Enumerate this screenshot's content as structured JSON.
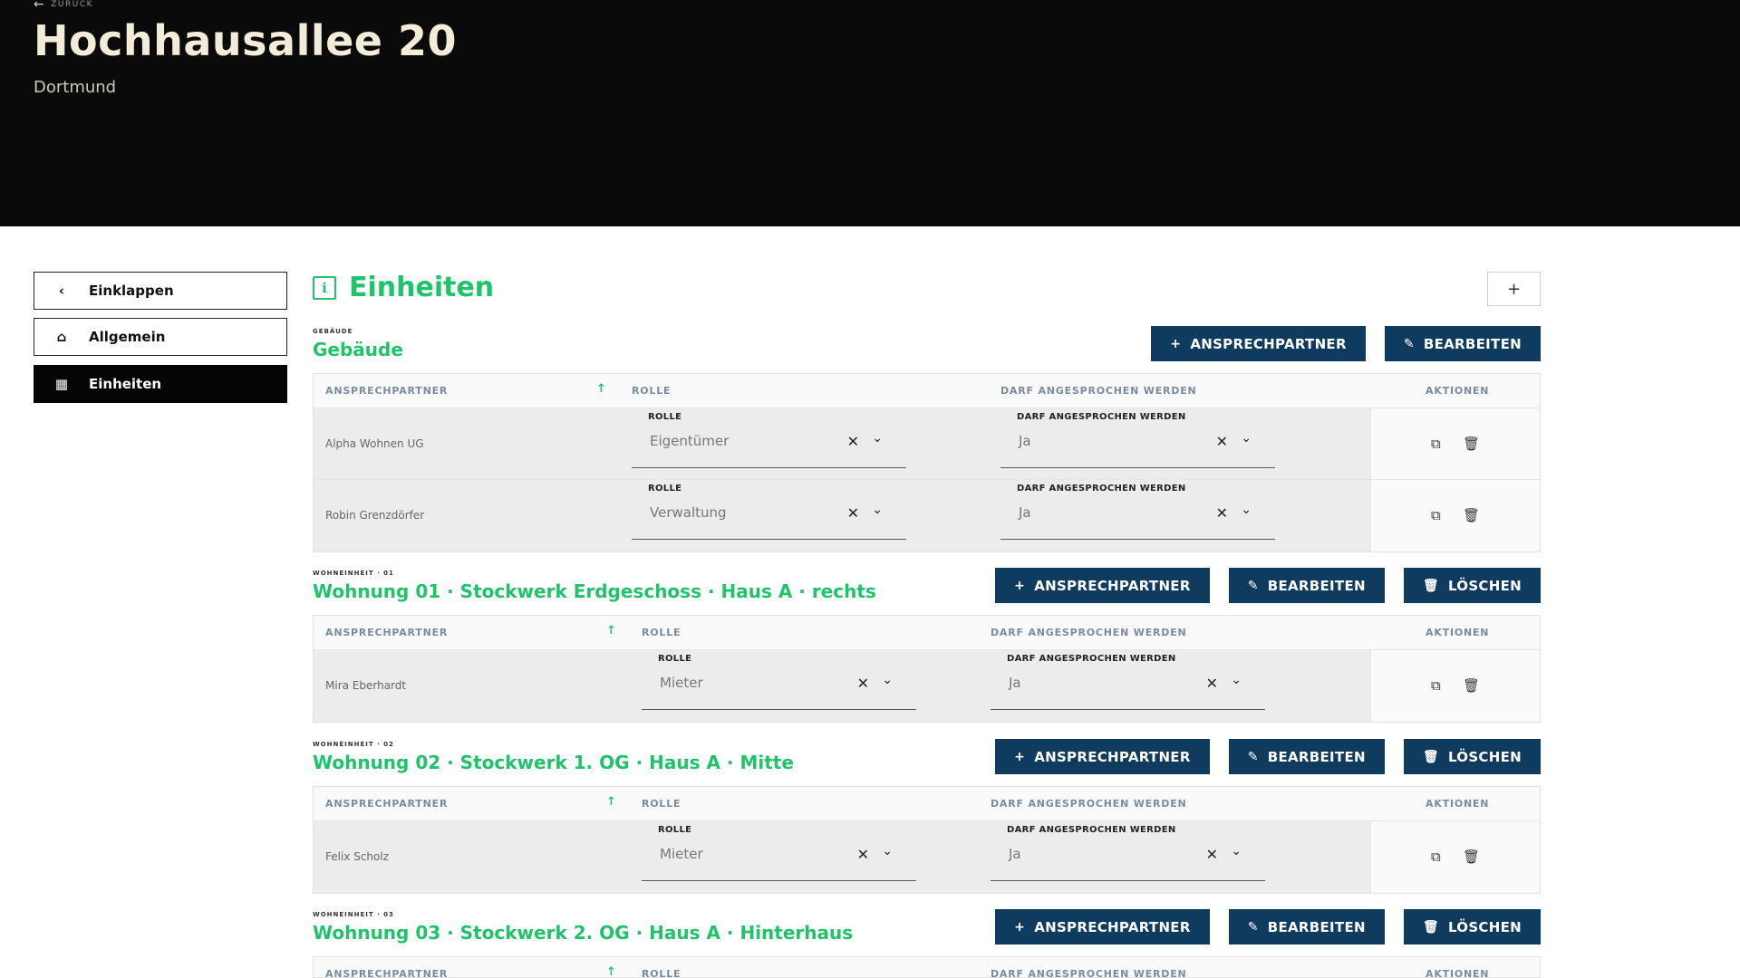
{
  "header": {
    "back_label": "ZURÜCK",
    "title": "Hochhausallee 20",
    "subtitle": "Dortmund"
  },
  "sidebar": {
    "items": [
      {
        "label": "Einklappen",
        "icon": "chevron-left-icon"
      },
      {
        "label": "Allgemein",
        "icon": "home-icon"
      },
      {
        "label": "Einheiten",
        "icon": "building-icon",
        "active": true
      }
    ]
  },
  "section": {
    "title": "Einheiten",
    "add_label": "+"
  },
  "colors": {
    "accent": "#1fc46a",
    "button": "#0f3b5f",
    "header_bg": "#0a0a0a"
  },
  "table_headers": {
    "partner": "ANSPRECHPARTNER",
    "rolle": "ROLLE",
    "darf": "DARF ANGESPROCHEN WERDEN",
    "aktionen": "AKTIONEN"
  },
  "field_labels": {
    "rolle": "ROLLE",
    "darf": "DARF ANGESPROCHEN WERDEN"
  },
  "buttons": {
    "ansprechpartner": "ANSPRECHPARTNER",
    "bearbeiten": "BEARBEITEN",
    "loeschen": "LÖSCHEN"
  },
  "units": [
    {
      "overline": "GEBÄUDE",
      "title": "Gebäude",
      "rows": [
        {
          "name": "Alpha Wohnen UG",
          "rolle": "Eigentümer",
          "darf": "Ja"
        },
        {
          "name": "Robin Grenzdörfer",
          "rolle": "Verwaltung",
          "darf": "Ja"
        }
      ]
    },
    {
      "overline": "WOHNEINHEIT · 01",
      "title": "Wohnung 01 · Stockwerk Erdgeschoss · Haus A · rechts",
      "rows": [
        {
          "name": "Mira Eberhardt",
          "rolle": "Mieter",
          "darf": "Ja"
        }
      ]
    },
    {
      "overline": "WOHNEINHEIT · 02",
      "title": "Wohnung 02 · Stockwerk 1. OG · Haus A · Mitte",
      "rows": [
        {
          "name": "Felix Scholz",
          "rolle": "Mieter",
          "darf": "Ja"
        }
      ]
    },
    {
      "overline": "WOHNEINHEIT · 03",
      "title": "Wohnung 03 · Stockwerk 2. OG · Haus A · Hinterhaus",
      "rows": []
    }
  ]
}
